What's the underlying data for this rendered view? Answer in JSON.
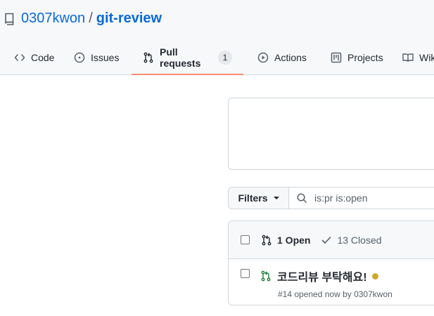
{
  "repo": {
    "icon": "repo-icon",
    "owner": "0307kwon",
    "separator": "/",
    "name": "git-review"
  },
  "tabs": [
    {
      "label": "Code",
      "icon": "code-icon"
    },
    {
      "label": "Issues",
      "icon": "issue-icon"
    },
    {
      "label": "Pull requests",
      "icon": "pull-request-icon",
      "counter": "1",
      "selected": true
    },
    {
      "label": "Actions",
      "icon": "play-icon"
    },
    {
      "label": "Projects",
      "icon": "project-icon"
    },
    {
      "label": "Wiki",
      "icon": "book-icon"
    }
  ],
  "filters": {
    "label": "Filters",
    "search_value": "is:pr is:open"
  },
  "list": {
    "open_label": "1 Open",
    "closed_label": "13 Closed",
    "items": [
      {
        "title": "코드리뷰 부탁해요!",
        "meta": "#14 opened now by 0307kwon",
        "status_color": "#d4a72c"
      }
    ]
  },
  "colors": {
    "link": "#0969da",
    "selected_tab_underline": "#fd8c73",
    "open_pr_green": "#1a7f37",
    "pending_dot": "#d4a72c"
  }
}
